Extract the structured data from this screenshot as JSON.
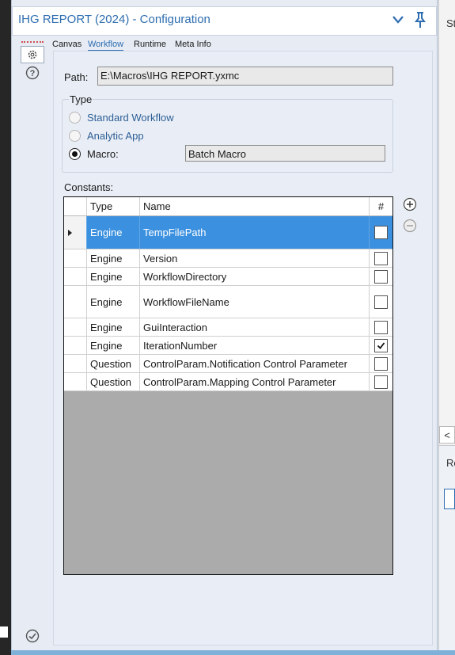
{
  "window": {
    "title": "IHG REPORT (2024) - Configuration"
  },
  "tabs": [
    "Canvas",
    "Workflow",
    "Runtime",
    "Meta Info"
  ],
  "selected_tab": "Workflow",
  "path": {
    "label": "Path:",
    "value": "E:\\Macros\\IHG REPORT.yxmc"
  },
  "type_group": {
    "label": "Type",
    "options": [
      "Standard Workflow",
      "Analytic App",
      "Macro:"
    ],
    "selected": "Macro:",
    "macro_value": "Batch Macro"
  },
  "constants": {
    "label": "Constants:",
    "headers": {
      "type": "Type",
      "name": "Name",
      "check": "#"
    },
    "rows": [
      {
        "type": "Engine",
        "name": "TempFilePath",
        "checked": false,
        "selected": true
      },
      {
        "type": "Engine",
        "name": "Version",
        "checked": false
      },
      {
        "type": "Engine",
        "name": "WorkflowDirectory",
        "checked": false
      },
      {
        "type": "Engine",
        "name": "WorkflowFileName",
        "checked": false
      },
      {
        "type": "Engine",
        "name": "GuiInteraction",
        "checked": false
      },
      {
        "type": "Engine",
        "name": "IterationNumber",
        "checked": true
      },
      {
        "type": "Question",
        "name": "ControlParam.Notification Control Parameter",
        "checked": false
      },
      {
        "type": "Question",
        "name": "ControlParam.Mapping Control Parameter",
        "checked": false
      }
    ]
  },
  "right_pane": {
    "top_text": "St",
    "mid_text": "Re",
    "arrow": "<"
  },
  "icons": {
    "settings": "gear-icon",
    "help": "help-circle-icon",
    "status": "check-circle-icon",
    "collapse": "chevron-down-icon",
    "pin": "pin-icon",
    "add": "add-circle-icon",
    "remove": "remove-circle-icon",
    "row_pointer": "triangle-right-icon"
  },
  "colors": {
    "accent": "#2d6db0",
    "selection": "#3b90df",
    "grid_empty": "#ababab"
  }
}
